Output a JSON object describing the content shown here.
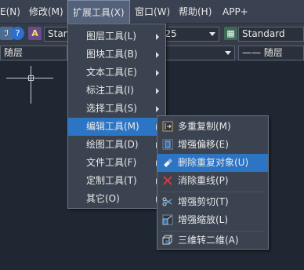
{
  "menubar": {
    "items": [
      {
        "label": "E(N)"
      },
      {
        "label": "修改(M)"
      },
      {
        "label": "扩展工具(X)"
      },
      {
        "label": "窗口(W)"
      },
      {
        "label": "帮助(H)"
      },
      {
        "label": "APP+"
      }
    ]
  },
  "toolbar": {
    "text_style": "Stan",
    "dim_value": "-25",
    "table_style": "Standard"
  },
  "layerbar": {
    "left_layer": "随层",
    "linetype": "—— 随层"
  },
  "dropdown": {
    "items": [
      {
        "label": "图层工具(L)"
      },
      {
        "label": "图块工具(B)"
      },
      {
        "label": "文本工具(E)"
      },
      {
        "label": "标注工具(I)"
      },
      {
        "label": "选择工具(S)"
      },
      {
        "label": "编辑工具(M)"
      },
      {
        "label": "绘图工具(D)"
      },
      {
        "label": "文件工具(F)"
      },
      {
        "label": "定制工具(T)"
      },
      {
        "label": "其它(O)"
      }
    ],
    "selected_index": 5
  },
  "submenu": {
    "items": [
      {
        "label": "多重复制(M)",
        "icon": "multi-copy-icon"
      },
      {
        "label": "增强偏移(E)",
        "icon": "enhanced-offset-icon"
      },
      {
        "label": "删除重复对象(U)",
        "icon": "delete-duplicates-icon"
      },
      {
        "label": "消除重线(P)",
        "icon": "remove-overlap-icon"
      },
      {
        "label": "增强剪切(T)",
        "icon": "enhanced-trim-icon"
      },
      {
        "label": "增强缩放(L)",
        "icon": "enhanced-scale-icon"
      },
      {
        "label": "三维转二维(A)",
        "icon": "3d-to-2d-icon"
      }
    ],
    "selected_index": 2
  },
  "colors": {
    "menu_bg": "#3b4350",
    "highlight": "#2c74c4",
    "canvas": "#1f2733"
  }
}
